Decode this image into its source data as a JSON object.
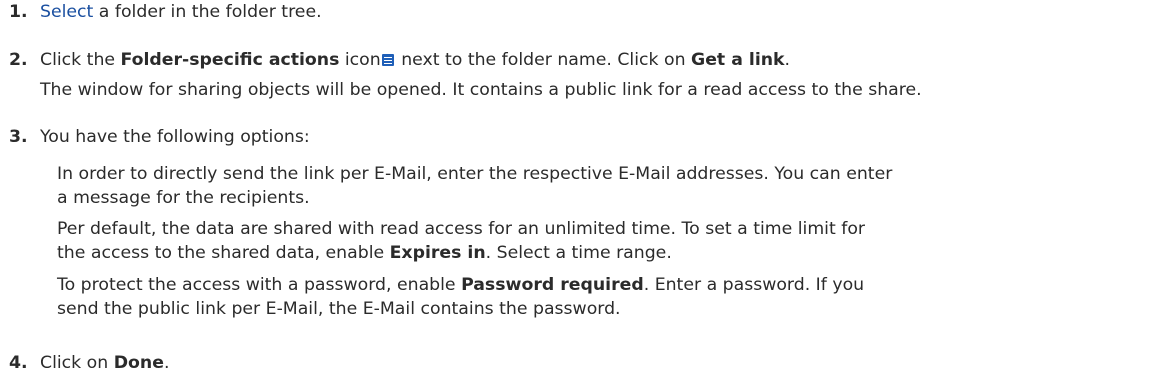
{
  "steps": [
    {
      "num": "1.",
      "link": "Select",
      "rest": " a folder in the folder tree."
    },
    {
      "num": "2.",
      "pre": "Click the ",
      "bold1": "Folder-specific actions",
      "mid1": " icon",
      "icon": "hamburger-menu-icon",
      "mid2": " next to the folder name. Click on ",
      "bold2": "Get a link",
      "end": ".",
      "note": "The window for sharing objects will be opened. It contains a public link for a read access to the share."
    },
    {
      "num": "3.",
      "text": "You have the following options:",
      "options": [
        {
          "line1": "In order to directly send the link per E-Mail, enter the respective E-Mail addresses. You can enter",
          "line2": "a message for the recipients."
        },
        {
          "line1": "Per default, the data are shared with read access for an unlimited time. To set a time limit for",
          "line2_pre": "the access to the shared data, enable ",
          "line2_bold": "Expires in",
          "line2_post": ". Select a time range."
        },
        {
          "line1_pre": "To protect the access with a password, enable ",
          "line1_bold": "Password required",
          "line1_post": ". Enter a password. If you",
          "line2": "send the public link per E-Mail, the E-Mail contains the password."
        }
      ]
    },
    {
      "num": "4.",
      "pre": "Click on ",
      "bold": "Done",
      "end": "."
    }
  ],
  "colors": {
    "link": "#1a4fa0",
    "icon": "#1f5fb8",
    "text": "#2b2b2b"
  }
}
